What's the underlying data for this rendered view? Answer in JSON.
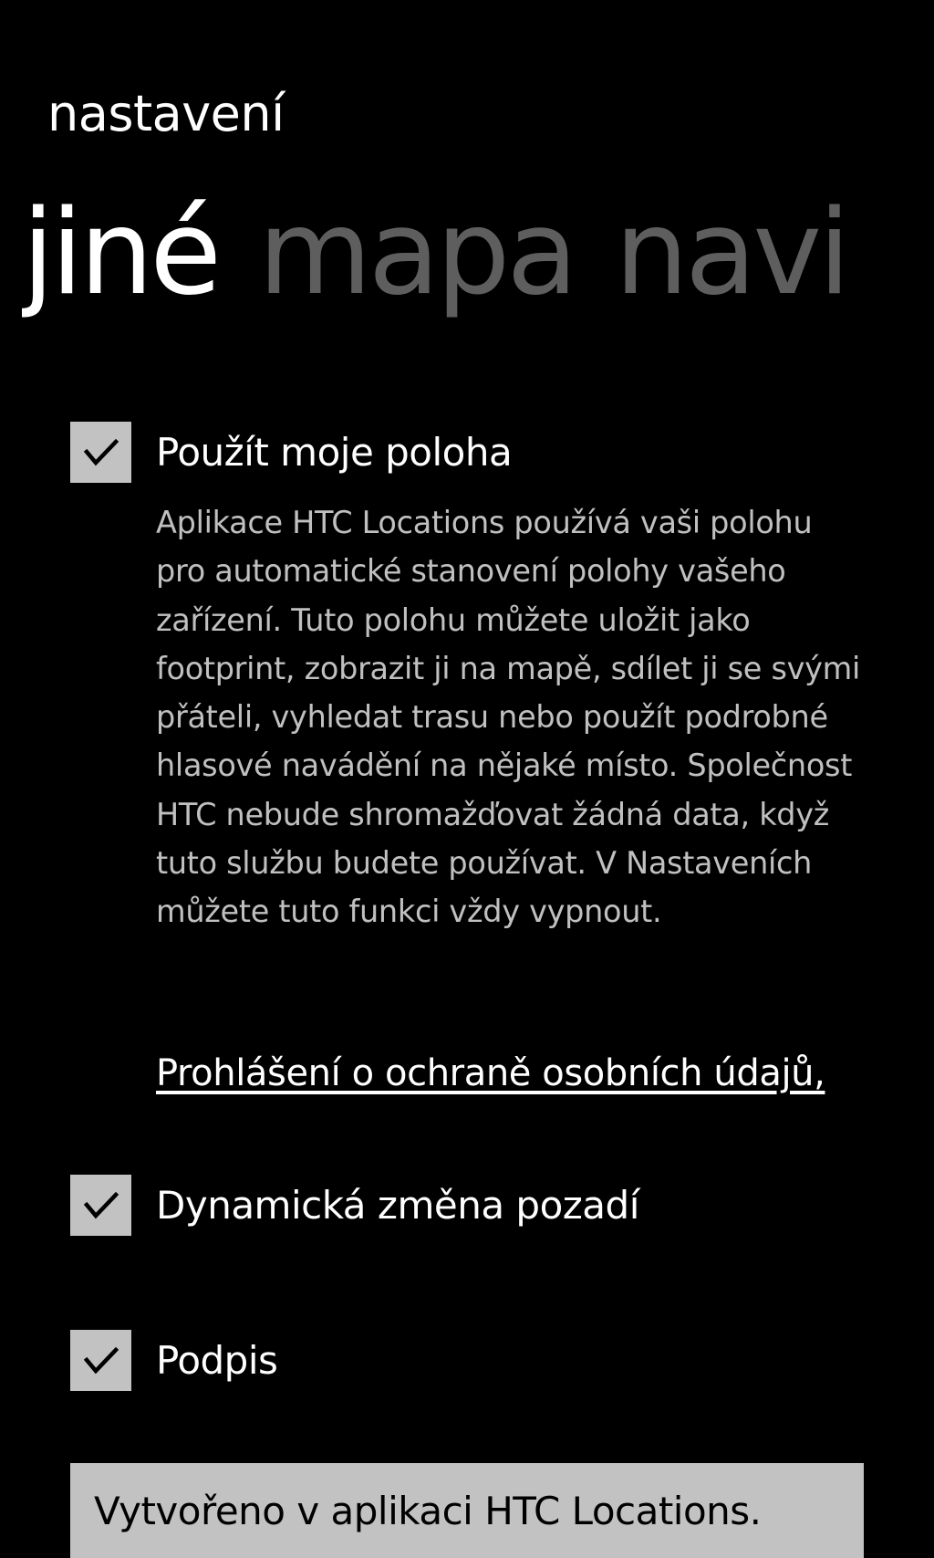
{
  "app": {
    "title": "nastavení"
  },
  "pivot": {
    "tabs": [
      {
        "label": "jiné",
        "active": true
      },
      {
        "label": "mapa",
        "active": false
      },
      {
        "label": "navi",
        "active": false
      }
    ]
  },
  "settings": {
    "use_location": {
      "label": "Použít moje poloha",
      "checked": true,
      "description": "Aplikace HTC Locations používá vaši polohu pro automatické stanovení polohy vašeho zařízení. Tuto polohu můžete uložit jako footprint, zobrazit ji na mapě, sdílet ji se svými přáteli, vyhledat trasu nebo použít podrobné hlasové navádění na nějaké místo. Společnost HTC nebude shromažďovat žádná data, když tuto službu budete používat. V Nastaveních můžete tuto funkci vždy vypnout."
    },
    "privacy_link": "Prohlášení o ochraně osobních údajů,",
    "dynamic_background": {
      "label": "Dynamická změna pozadí",
      "checked": true
    },
    "signature": {
      "label": "Podpis",
      "checked": true,
      "value": "Vytvořeno v aplikaci HTC Locations."
    }
  },
  "colors": {
    "background": "#000000",
    "text": "#ffffff",
    "text_secondary": "#c0c0c0",
    "tab_inactive": "#5e5e5e",
    "control_fill": "#c2c2c2"
  },
  "icons": {
    "checkbox_mark": "check-icon"
  }
}
